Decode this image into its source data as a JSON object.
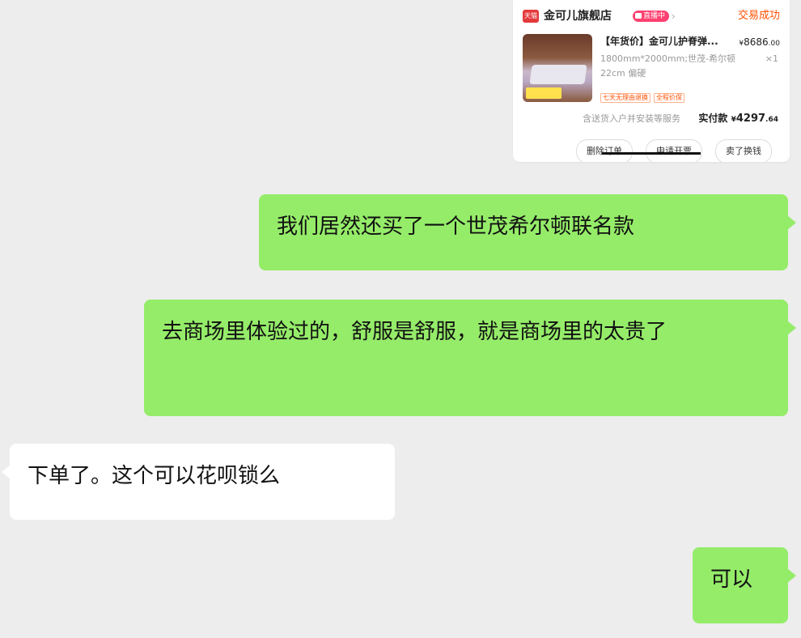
{
  "order_card": {
    "platform_icon": "天猫",
    "store_name": "金可儿旗舰店",
    "live_badge": "直播中",
    "chevron": "›",
    "status": "交易成功",
    "product": {
      "title": "【年货价】金可儿护脊弹...",
      "price_yen": "¥",
      "price_main": "8686",
      "price_cents": ".00",
      "spec": "1800mm*2000mm;世茂-希尔顿  22cm  偏硬",
      "quantity": "×1",
      "tags": [
        "七天无理由退换",
        "全程价保"
      ]
    },
    "service_note": "含送货入户并安装等服务",
    "paid_label": "实付款",
    "paid_yen": "¥",
    "paid_main": "4297",
    "paid_cents": ".64",
    "buttons": {
      "delete": "删除订单",
      "invoice": "申请开票",
      "resell": "卖了换钱"
    },
    "colors": {
      "accent": "#ff5000",
      "live": "#ff4070",
      "tmall": "#e4393c"
    }
  },
  "messages": [
    {
      "side": "right",
      "text": "我们居然还买了一个世茂希尔顿联名款"
    },
    {
      "side": "right",
      "text": "去商场里体验过的，舒服是舒服，就是商场里的太贵了"
    },
    {
      "side": "left",
      "text": "下单了。这个可以花呗锁么"
    },
    {
      "side": "right",
      "text": "可以"
    }
  ],
  "colors": {
    "background": "#ededed",
    "my_bubble": "#95ec69",
    "their_bubble": "#ffffff"
  }
}
